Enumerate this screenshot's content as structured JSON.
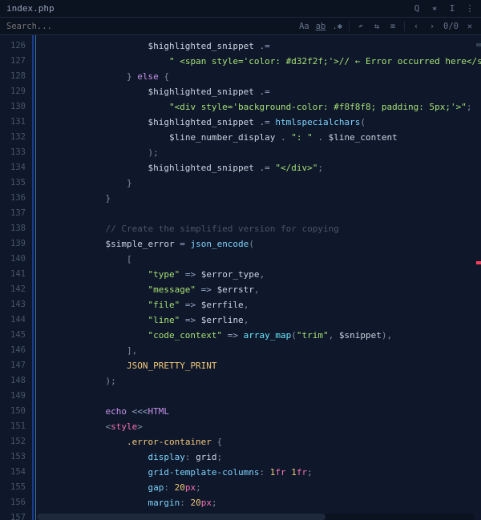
{
  "tab": {
    "filename": "index.php"
  },
  "search": {
    "placeholder": "Search...",
    "value": "",
    "match_case_label": "Aa",
    "position": "0/0"
  },
  "gutter_start": 126,
  "gutter_count": 32,
  "code_lines": [
    {
      "indent": 5,
      "tokens": [
        {
          "t": "$highlighted_snippet",
          "c": "c-var"
        },
        {
          "t": " ",
          "c": "c-op"
        },
        {
          "t": ".=",
          "c": "c-op"
        }
      ]
    },
    {
      "indent": 6,
      "tokens": [
        {
          "t": "\" <span style='color: ",
          "c": "c-str"
        },
        {
          "t": "#d32f2f",
          "c": "c-str"
        },
        {
          "t": ";'>// ← Error occurred here</span></div>\"",
          "c": "c-str"
        },
        {
          "t": ";",
          "c": "c-punc"
        }
      ]
    },
    {
      "indent": 4,
      "tokens": [
        {
          "t": "}",
          "c": "c-punc"
        },
        {
          "t": " ",
          "c": "c-op"
        },
        {
          "t": "else",
          "c": "c-kw"
        },
        {
          "t": " {",
          "c": "c-punc"
        }
      ]
    },
    {
      "indent": 5,
      "tokens": [
        {
          "t": "$highlighted_snippet",
          "c": "c-var"
        },
        {
          "t": " ",
          "c": "c-op"
        },
        {
          "t": ".=",
          "c": "c-op"
        }
      ]
    },
    {
      "indent": 6,
      "tokens": [
        {
          "t": "\"<div style='background-color: ",
          "c": "c-str"
        },
        {
          "t": "#f8f8f8",
          "c": "c-str"
        },
        {
          "t": "; padding: 5px;'>\"",
          "c": "c-str"
        },
        {
          "t": ";",
          "c": "c-punc"
        }
      ]
    },
    {
      "indent": 5,
      "tokens": [
        {
          "t": "$highlighted_snippet",
          "c": "c-var"
        },
        {
          "t": " ",
          "c": "c-op"
        },
        {
          "t": ".=",
          "c": "c-op"
        },
        {
          "t": " ",
          "c": "c-op"
        },
        {
          "t": "htmlspecialchars",
          "c": "c-fn"
        },
        {
          "t": "(",
          "c": "c-punc"
        }
      ]
    },
    {
      "indent": 6,
      "tokens": [
        {
          "t": "$line_number_display",
          "c": "c-var"
        },
        {
          "t": " . ",
          "c": "c-op"
        },
        {
          "t": "\": \"",
          "c": "c-str"
        },
        {
          "t": " . ",
          "c": "c-op"
        },
        {
          "t": "$line_content",
          "c": "c-var"
        }
      ]
    },
    {
      "indent": 5,
      "tokens": [
        {
          "t": ");",
          "c": "c-punc"
        }
      ]
    },
    {
      "indent": 5,
      "tokens": [
        {
          "t": "$highlighted_snippet",
          "c": "c-var"
        },
        {
          "t": " ",
          "c": "c-op"
        },
        {
          "t": ".=",
          "c": "c-op"
        },
        {
          "t": " ",
          "c": "c-op"
        },
        {
          "t": "\"</div>\"",
          "c": "c-str"
        },
        {
          "t": ";",
          "c": "c-punc"
        }
      ]
    },
    {
      "indent": 4,
      "tokens": [
        {
          "t": "}",
          "c": "c-punc"
        }
      ]
    },
    {
      "indent": 3,
      "tokens": [
        {
          "t": "}",
          "c": "c-punc"
        }
      ]
    },
    {
      "indent": 0,
      "tokens": []
    },
    {
      "indent": 3,
      "tokens": [
        {
          "t": "// Create the simplified version for copying",
          "c": "c-cmt"
        }
      ]
    },
    {
      "indent": 3,
      "tokens": [
        {
          "t": "$simple_error",
          "c": "c-var"
        },
        {
          "t": " = ",
          "c": "c-op"
        },
        {
          "t": "json_encode",
          "c": "c-fn"
        },
        {
          "t": "(",
          "c": "c-punc"
        }
      ]
    },
    {
      "indent": 4,
      "tokens": [
        {
          "t": "[",
          "c": "c-punc"
        }
      ]
    },
    {
      "indent": 5,
      "tokens": [
        {
          "t": "\"type\"",
          "c": "c-str"
        },
        {
          "t": " => ",
          "c": "c-op"
        },
        {
          "t": "$error_type",
          "c": "c-var"
        },
        {
          "t": ",",
          "c": "c-punc"
        }
      ]
    },
    {
      "indent": 5,
      "tokens": [
        {
          "t": "\"message\"",
          "c": "c-str"
        },
        {
          "t": " => ",
          "c": "c-op"
        },
        {
          "t": "$errstr",
          "c": "c-var"
        },
        {
          "t": ",",
          "c": "c-punc"
        }
      ]
    },
    {
      "indent": 5,
      "tokens": [
        {
          "t": "\"file\"",
          "c": "c-str"
        },
        {
          "t": " => ",
          "c": "c-op"
        },
        {
          "t": "$errfile",
          "c": "c-var"
        },
        {
          "t": ",",
          "c": "c-punc"
        }
      ]
    },
    {
      "indent": 5,
      "tokens": [
        {
          "t": "\"line\"",
          "c": "c-str"
        },
        {
          "t": " => ",
          "c": "c-op"
        },
        {
          "t": "$errline",
          "c": "c-var"
        },
        {
          "t": ",",
          "c": "c-punc"
        }
      ]
    },
    {
      "indent": 5,
      "tokens": [
        {
          "t": "\"code_context\"",
          "c": "c-str"
        },
        {
          "t": " => ",
          "c": "c-op"
        },
        {
          "t": "array_map",
          "c": "c-fn2"
        },
        {
          "t": "(",
          "c": "c-punc"
        },
        {
          "t": "\"trim\"",
          "c": "c-str"
        },
        {
          "t": ", ",
          "c": "c-punc"
        },
        {
          "t": "$snippet",
          "c": "c-var"
        },
        {
          "t": "),",
          "c": "c-punc"
        }
      ]
    },
    {
      "indent": 4,
      "tokens": [
        {
          "t": "],",
          "c": "c-punc"
        }
      ]
    },
    {
      "indent": 4,
      "tokens": [
        {
          "t": "JSON_PRETTY_PRINT",
          "c": "c-const"
        }
      ]
    },
    {
      "indent": 3,
      "tokens": [
        {
          "t": ");",
          "c": "c-punc"
        }
      ]
    },
    {
      "indent": 0,
      "tokens": []
    },
    {
      "indent": 3,
      "tokens": [
        {
          "t": "echo",
          "c": "c-kw"
        },
        {
          "t": " ",
          "c": "c-op"
        },
        {
          "t": "<<<",
          "c": "c-op"
        },
        {
          "t": "HTML",
          "c": "c-html"
        }
      ]
    },
    {
      "indent": 3,
      "tokens": [
        {
          "t": "<",
          "c": "c-punc"
        },
        {
          "t": "style",
          "c": "c-tag"
        },
        {
          "t": ">",
          "c": "c-punc"
        }
      ]
    },
    {
      "indent": 4,
      "tokens": [
        {
          "t": ".error-container",
          "c": "c-const"
        },
        {
          "t": " {",
          "c": "c-punc"
        }
      ]
    },
    {
      "indent": 5,
      "tokens": [
        {
          "t": "display",
          "c": "c-prop"
        },
        {
          "t": ": ",
          "c": "c-punc"
        },
        {
          "t": "grid",
          "c": "c-var"
        },
        {
          "t": ";",
          "c": "c-punc"
        }
      ]
    },
    {
      "indent": 5,
      "tokens": [
        {
          "t": "grid-template-columns",
          "c": "c-prop"
        },
        {
          "t": ": ",
          "c": "c-punc"
        },
        {
          "t": "1",
          "c": "c-num"
        },
        {
          "t": "fr",
          "c": "c-unit"
        },
        {
          "t": " ",
          "c": "c-op"
        },
        {
          "t": "1",
          "c": "c-num"
        },
        {
          "t": "fr",
          "c": "c-unit"
        },
        {
          "t": ";",
          "c": "c-punc"
        }
      ]
    },
    {
      "indent": 5,
      "tokens": [
        {
          "t": "gap",
          "c": "c-prop"
        },
        {
          "t": ": ",
          "c": "c-punc"
        },
        {
          "t": "20",
          "c": "c-num"
        },
        {
          "t": "px",
          "c": "c-unit"
        },
        {
          "t": ";",
          "c": "c-punc"
        }
      ]
    },
    {
      "indent": 5,
      "tokens": [
        {
          "t": "margin",
          "c": "c-prop"
        },
        {
          "t": ": ",
          "c": "c-punc"
        },
        {
          "t": "20",
          "c": "c-num"
        },
        {
          "t": "px",
          "c": "c-unit"
        },
        {
          "t": ";",
          "c": "c-punc"
        }
      ]
    },
    {
      "indent": 4,
      "tokens": [
        {
          "t": "}",
          "c": "c-punc"
        }
      ]
    }
  ]
}
